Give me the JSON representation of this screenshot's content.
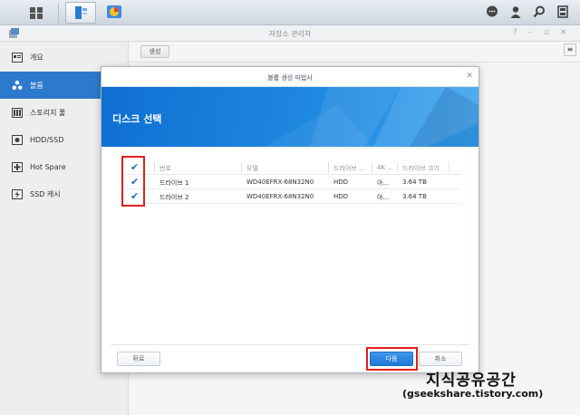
{
  "taskbar": {
    "icons": [
      "main-menu-icon",
      "storage-manager-icon",
      "control-panel-icon"
    ],
    "right_icons": [
      "chat-icon",
      "user-icon",
      "search-icon",
      "widgets-icon"
    ]
  },
  "window": {
    "title": "저장소 관리자",
    "controls": [
      "?",
      "–",
      "▫",
      "✕"
    ]
  },
  "sidebar": {
    "items": [
      {
        "label": "개요",
        "icon": "overview-icon"
      },
      {
        "label": "볼륨",
        "icon": "volume-icon",
        "active": true
      },
      {
        "label": "스토리지 풀",
        "icon": "storage-pool-icon"
      },
      {
        "label": "HDD/SSD",
        "icon": "hdd-icon"
      },
      {
        "label": "Hot Spare",
        "icon": "hot-spare-icon"
      },
      {
        "label": "SSD 캐시",
        "icon": "ssd-cache-icon"
      }
    ]
  },
  "toolbar": {
    "create_label": "생성"
  },
  "dialog": {
    "title": "볼륨 생성 마법사",
    "close": "✕",
    "banner_title": "디스크 선택",
    "columns": [
      "번호",
      "모델",
      "드라이브 ...",
      "4K ...",
      "드라이브 크기"
    ],
    "rows": [
      {
        "number": "드라이브 1",
        "model": "WD40EFRX-68N32N0",
        "type": "HDD",
        "fourk": "아...",
        "size": "3.64 TB",
        "checked": true
      },
      {
        "number": "드라이브 2",
        "model": "WD40EFRX-68N32N0",
        "type": "HDD",
        "fourk": "아...",
        "size": "3.64 TB",
        "checked": true
      }
    ],
    "back_label": "뒤로",
    "next_label": "다음",
    "cancel_label": "취소"
  },
  "colors": {
    "accent": "#2f7fd6",
    "highlight": "#e0201b"
  },
  "watermark": {
    "line1": "지식공유공간",
    "line2": "(gseekshare.tistory.com)"
  }
}
